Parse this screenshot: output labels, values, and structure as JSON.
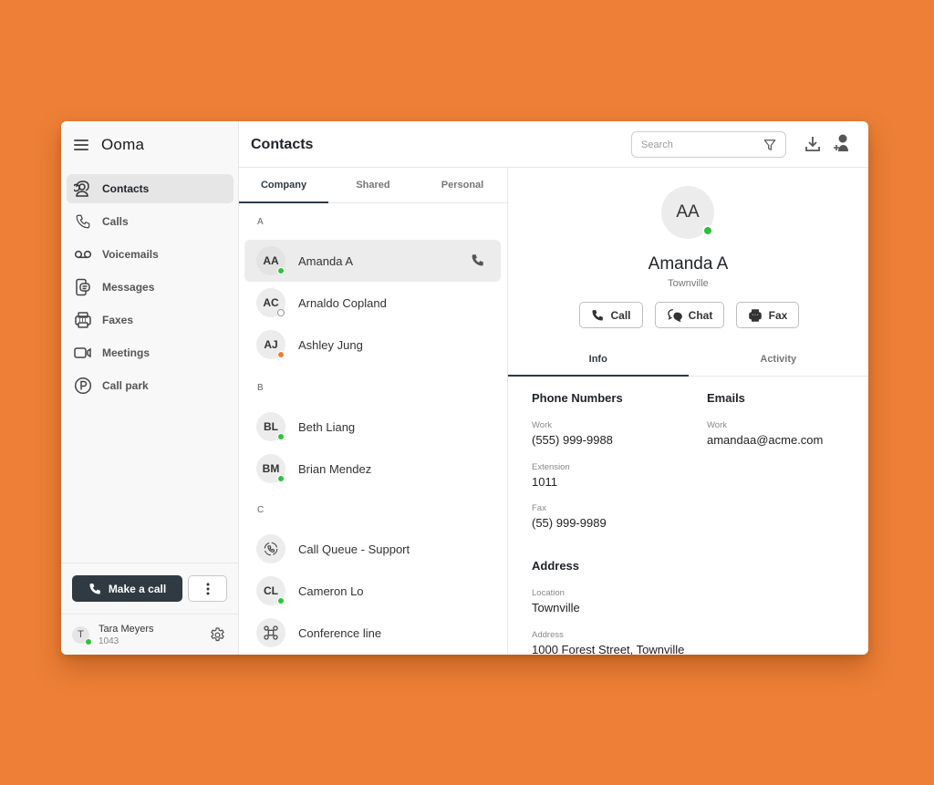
{
  "app": {
    "name": "Ooma"
  },
  "sidebar": {
    "items": [
      {
        "label": "Contacts",
        "icon": "contacts-icon",
        "active": true
      },
      {
        "label": "Calls",
        "icon": "phone-icon",
        "active": false
      },
      {
        "label": "Voicemails",
        "icon": "voicemail-icon",
        "active": false
      },
      {
        "label": "Messages",
        "icon": "messages-icon",
        "active": false
      },
      {
        "label": "Faxes",
        "icon": "fax-icon",
        "active": false
      },
      {
        "label": "Meetings",
        "icon": "video-icon",
        "active": false
      },
      {
        "label": "Call park",
        "icon": "parking-icon",
        "active": false
      }
    ],
    "make_call_label": "Make a call",
    "more_icon": "more-vertical-icon",
    "user": {
      "initial": "T",
      "name": "Tara Meyers",
      "extension": "1043",
      "status": "online"
    }
  },
  "header": {
    "title": "Contacts",
    "search_placeholder": "Search",
    "search_value": "",
    "icons": [
      "filter-icon",
      "download-icon",
      "add-user-icon"
    ]
  },
  "list": {
    "tabs": [
      {
        "label": "Company",
        "active": true
      },
      {
        "label": "Shared",
        "active": false
      },
      {
        "label": "Personal",
        "active": false
      }
    ],
    "groups": [
      {
        "letter": "A",
        "contacts": [
          {
            "initials": "AA",
            "name": "Amanda A",
            "status": "online",
            "active": true
          },
          {
            "initials": "AC",
            "name": "Arnaldo Copland",
            "status": "offline"
          },
          {
            "initials": "AJ",
            "name": "Ashley Jung",
            "status": "on-call"
          }
        ]
      },
      {
        "letter": "B",
        "contacts": [
          {
            "initials": "BL",
            "name": "Beth Liang",
            "status": "online"
          },
          {
            "initials": "BM",
            "name": "Brian Mendez",
            "status": "online"
          }
        ]
      },
      {
        "letter": "C",
        "contacts": [
          {
            "initials": "",
            "name": "Call Queue - Support",
            "icon": "call-queue-icon"
          },
          {
            "initials": "CL",
            "name": "Cameron Lo",
            "status": "online"
          },
          {
            "initials": "",
            "name": "Conference line",
            "icon": "conference-icon"
          }
        ]
      }
    ]
  },
  "detail": {
    "initials": "AA",
    "name": "Amanda A",
    "location": "Townville",
    "status": "online",
    "actions": [
      {
        "label": "Call",
        "icon": "phone-icon"
      },
      {
        "label": "Chat",
        "icon": "chat-icon"
      },
      {
        "label": "Fax",
        "icon": "fax-icon"
      }
    ],
    "tabs": [
      {
        "label": "Info",
        "active": true
      },
      {
        "label": "Activity",
        "active": false
      }
    ],
    "phone_numbers": {
      "title": "Phone Numbers",
      "fields": [
        {
          "label": "Work",
          "value": "(555) 999-9988"
        },
        {
          "label": "Extension",
          "value": "1011"
        },
        {
          "label": "Fax",
          "value": "(55) 999-9989"
        }
      ]
    },
    "emails": {
      "title": "Emails",
      "fields": [
        {
          "label": "Work",
          "value": "amandaa@acme.com"
        }
      ]
    },
    "address": {
      "title": "Address",
      "fields": [
        {
          "label": "Location",
          "value": "Townville"
        },
        {
          "label": "Address",
          "value": "1000 Forest Street, Townville"
        }
      ]
    }
  },
  "colors": {
    "background": "#ED7F36",
    "primary_button": "#2f3a43",
    "online": "#2ec13a",
    "on_call": "#ED7F36"
  }
}
